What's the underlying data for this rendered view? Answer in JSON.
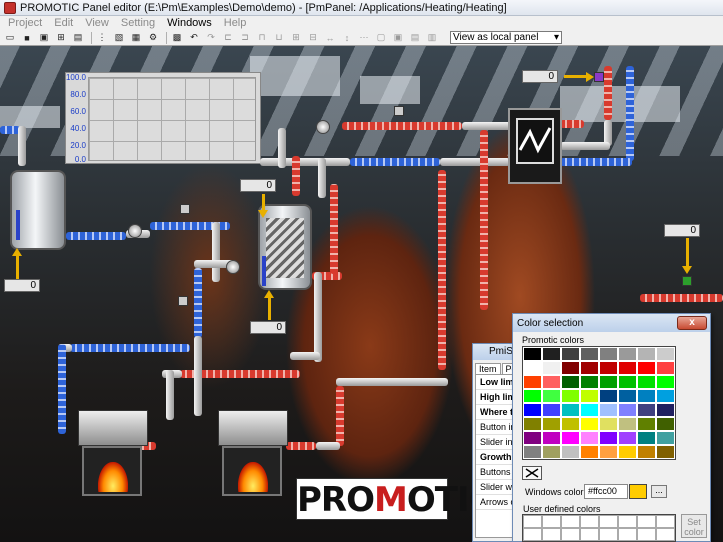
{
  "window": {
    "title": "PROMOTIC Panel editor (E:\\Pm\\Examples\\Demo\\demo)  - [PmPanel: /Applications/Heating/Heating]"
  },
  "menu": {
    "items": [
      {
        "label": "Project",
        "enabled": false
      },
      {
        "label": "Edit",
        "enabled": false
      },
      {
        "label": "View",
        "enabled": false
      },
      {
        "label": "Setting",
        "enabled": false
      },
      {
        "label": "Windows",
        "enabled": true
      },
      {
        "label": "Help",
        "enabled": false
      }
    ]
  },
  "toolbar": {
    "view_select": "View as local panel"
  },
  "trend": {
    "ticks": [
      "100.0",
      "80.0",
      "60.0",
      "40.0",
      "20.0",
      "0.0"
    ]
  },
  "values": {
    "top_right_1": "0",
    "top_right_2": "0",
    "center_top": "0",
    "left_tank": "0",
    "mixer": "0"
  },
  "pmislider": {
    "title": "PmiSlide",
    "tabs": [
      "Item",
      "Posit"
    ],
    "rows": [
      {
        "label": "Low limi",
        "bold": true
      },
      {
        "label": "High limi",
        "bold": true
      },
      {
        "label": "Where to",
        "bold": true
      },
      {
        "label": "Button incr",
        "bold": false
      },
      {
        "label": "Slider incre",
        "bold": false
      },
      {
        "label": "Growth di",
        "bold": true
      },
      {
        "label": "Buttons co",
        "bold": false
      },
      {
        "label": "Slider width",
        "bold": false
      },
      {
        "label": "Arrows colo",
        "bold": false
      }
    ]
  },
  "color_dialog": {
    "title": "Color selection",
    "close_label": "x",
    "promotic_label": "Promotic colors",
    "windows_color_label": "Windows color",
    "windows_color_value": "#ffcc00",
    "windows_color_swatch": "#ffcc00",
    "dots_label": "...",
    "user_label": "User defined colors",
    "set_color_label": "Set color",
    "swatches": [
      "#000000",
      "#202020",
      "#404040",
      "#606060",
      "#808080",
      "#9a9a9a",
      "#b4b4b4",
      "#cccccc",
      "#ffffff",
      "#f0f0f0",
      "#800000",
      "#a00000",
      "#c00000",
      "#e00000",
      "#ff0000",
      "#ff4040",
      "#ff4000",
      "#ff6060",
      "#006000",
      "#008000",
      "#00a000",
      "#00c000",
      "#00e000",
      "#00ff00",
      "#00ff00",
      "#40ff40",
      "#80ff00",
      "#c0ff00",
      "#004080",
      "#0060a0",
      "#0080c0",
      "#00a0e0",
      "#0000ff",
      "#4040ff",
      "#00c0c0",
      "#00ffff",
      "#a0c0ff",
      "#8080ff",
      "#404080",
      "#202060",
      "#808000",
      "#a0a000",
      "#c0c000",
      "#ffff00",
      "#e0e060",
      "#c0c080",
      "#608000",
      "#406000",
      "#800080",
      "#c000c0",
      "#ff00ff",
      "#ff80ff",
      "#8000ff",
      "#a040ff",
      "#008080",
      "#40a0a0",
      "#808080",
      "#a0a060",
      "#c0c0c0",
      "#ff8000",
      "#ffa040",
      "#ffcc00",
      "#c08000",
      "#806000"
    ]
  },
  "logo": {
    "text_a": "PRO",
    "text_m": "M",
    "text_b": "OTIC"
  },
  "colors": {
    "pipe_red": "#d83a2e",
    "pipe_blue": "#2e63d8",
    "arrow_yellow": "#e8b000",
    "trend_axis": "#1a3cc7"
  }
}
